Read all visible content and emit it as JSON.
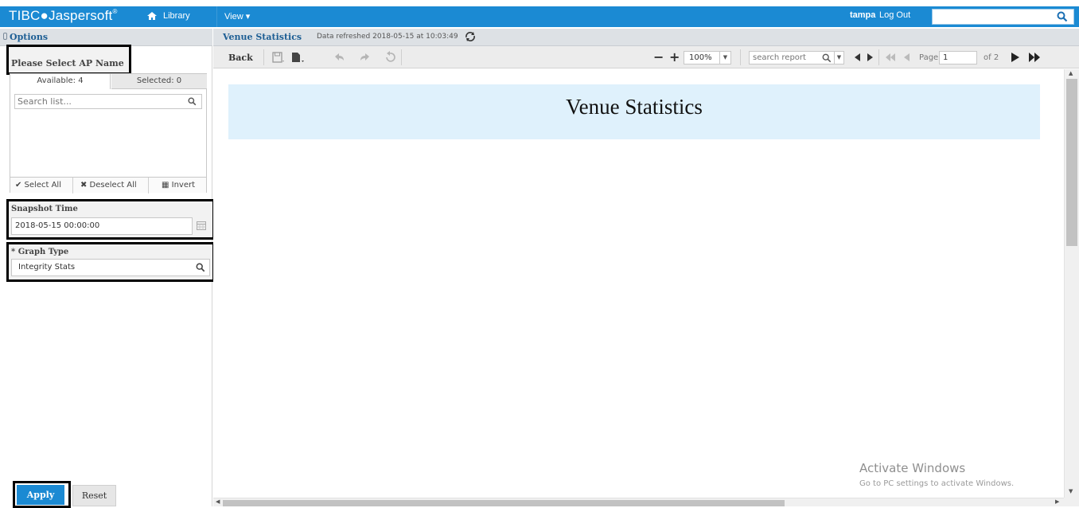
{
  "topbar": {
    "logo_brand": "TIBC",
    "logo_product": "Jaspersoft",
    "logo_tm": "®",
    "nav_library": "Library",
    "nav_view": "View ▾",
    "user": "tampa",
    "logout": "Log Out",
    "search_value": "",
    "accent_color": "#1b8ad3"
  },
  "options": {
    "header": "Options",
    "ap_label": "Please Select AP Name",
    "tab_available": "Available: 4",
    "tab_selected": "Selected: 0",
    "list_search_placeholder": "Search list...",
    "select_all": "✔ Select All",
    "deselect_all": "✖ Deselect All",
    "invert": "Invert",
    "snapshot_label": "Snapshot Time",
    "snapshot_value": "2018-05-15 00:00:00",
    "graph_type_label": "* Graph Type",
    "graph_type_value": "Integrity Stats",
    "apply": "Apply",
    "reset": "Reset"
  },
  "report": {
    "title": "Venue Statistics",
    "refreshed": "Data refreshed 2018-05-15 at 10:03:49",
    "back": "Back",
    "zoom": "100%",
    "search_placeholder": "search report",
    "page_label": "Page",
    "page_value": "1",
    "page_of": "of 2",
    "banner_title": "Venue Statistics"
  },
  "watermark": {
    "line1": "Activate Windows",
    "line2": "Go to PC settings to activate Windows."
  }
}
